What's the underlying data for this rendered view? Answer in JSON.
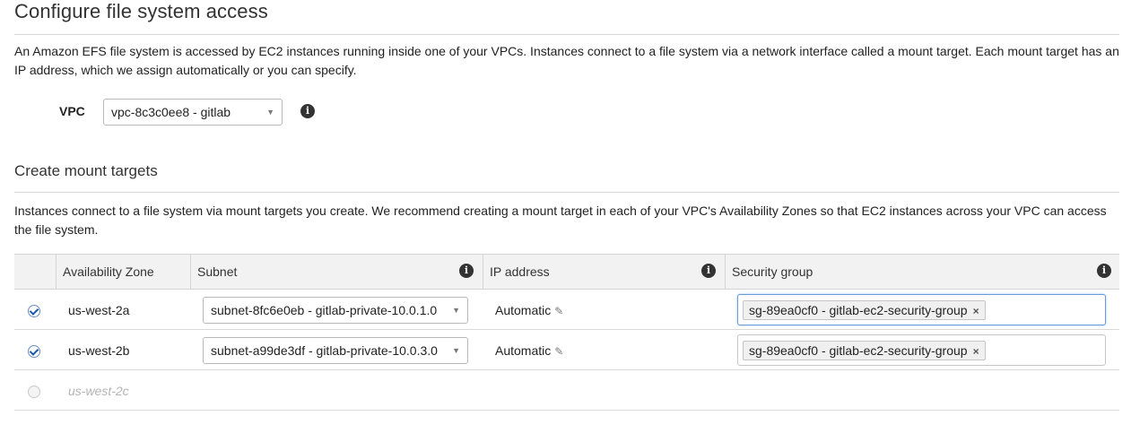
{
  "header": {
    "title": "Configure file system access",
    "description": "An Amazon EFS file system is accessed by EC2 instances running inside one of your VPCs. Instances connect to a file system via a network interface called a mount target. Each mount target has an IP address, which we assign automatically or you can specify."
  },
  "vpc": {
    "label": "VPC",
    "selected": "vpc-8c3c0ee8 - gitlab",
    "info_icon": "info-icon"
  },
  "mount_targets": {
    "title": "Create mount targets",
    "description": "Instances connect to a file system via mount targets you create. We recommend creating a mount target in each of your VPC's Availability Zones so that EC2 instances across your VPC can access the file system.",
    "columns": {
      "zone": "Availability Zone",
      "subnet": "Subnet",
      "ip": "IP address",
      "security": "Security group"
    },
    "rows": [
      {
        "checked": true,
        "zone": "us-west-2a",
        "subnet": "subnet-8fc6e0eb - gitlab-private-10.0.1.0",
        "ip": "Automatic",
        "security_group": "sg-89ea0cf0 - gitlab-ec2-security-group"
      },
      {
        "checked": true,
        "zone": "us-west-2b",
        "subnet": "subnet-a99de3df - gitlab-private-10.0.3.0",
        "ip": "Automatic",
        "security_group": "sg-89ea0cf0 - gitlab-ec2-security-group"
      },
      {
        "checked": false,
        "zone": "us-west-2c"
      }
    ]
  },
  "icons": {
    "pencil": "pencil-icon",
    "remove": "remove-token-icon",
    "caret": "caret-down-icon"
  },
  "colors": {
    "focus_border": "#6b9bd8",
    "checkbox_check": "#1a5aa8"
  }
}
